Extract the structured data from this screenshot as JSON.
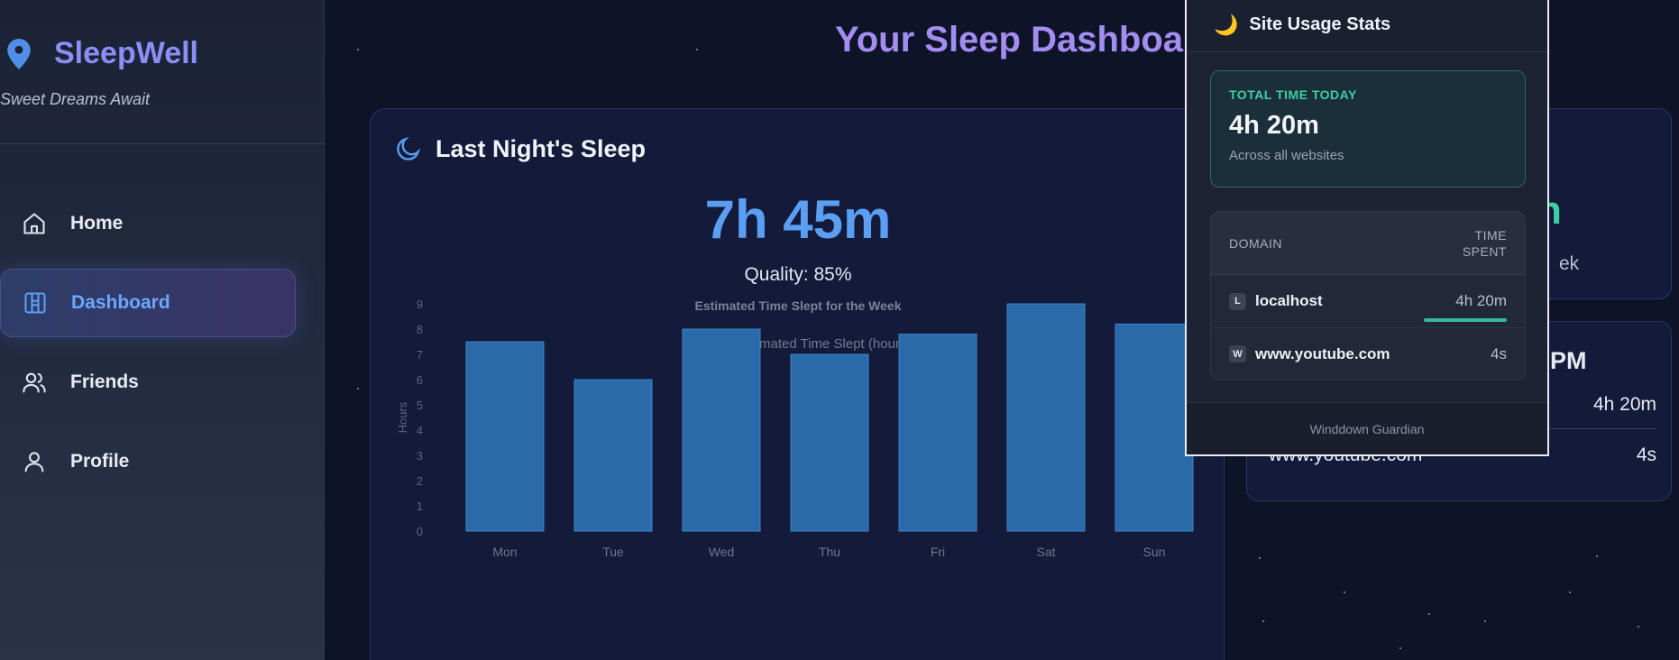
{
  "colors": {
    "background": "#0e1428",
    "accent": "#5b9ef2",
    "brand": "#8b8ff5",
    "bar_fill": "#2b6aa8",
    "teal": "#3ccfa4"
  },
  "sidebar": {
    "brand_title": "SleepWell",
    "tagline": "Sweet Dreams Await",
    "items": [
      {
        "label": "Home",
        "icon": "home-icon",
        "active": false
      },
      {
        "label": "Dashboard",
        "icon": "dashboard-icon",
        "active": true
      },
      {
        "label": "Friends",
        "icon": "users-icon",
        "active": false
      },
      {
        "label": "Profile",
        "icon": "user-icon",
        "active": false
      }
    ]
  },
  "main": {
    "title": "Your Sleep Dashboard",
    "sleep_card": {
      "heading": "Last Night's Sleep",
      "duration": "7h 45m",
      "quality": "Quality: 85%"
    },
    "right_cards": {
      "stat_value_fragment": "n",
      "stat_label_fragment": "ek",
      "time_heading_fragment": "PM",
      "row1_value": "4h 20m",
      "row2_domain": "www.youtube.com",
      "row2_value": "4s"
    }
  },
  "chart_data": {
    "type": "bar",
    "title": "Estimated Time Slept for the Week",
    "legend": [
      "Estimated Time Slept (hours)"
    ],
    "ylabel": "Hours",
    "xlabel": "",
    "categories": [
      "Mon",
      "Tue",
      "Wed",
      "Thu",
      "Fri",
      "Sat",
      "Sun"
    ],
    "values": [
      7.5,
      6,
      8,
      7,
      7.8,
      9,
      8.2
    ],
    "ylim": [
      0,
      9
    ],
    "yticks": [
      "0",
      "1",
      "2",
      "3",
      "4",
      "5",
      "6",
      "7",
      "8",
      "9"
    ],
    "grid": false,
    "legend_position": "top"
  },
  "popup": {
    "title": "Site Usage Stats",
    "moon_glyph": "🌙",
    "total": {
      "label": "TOTAL TIME TODAY",
      "value": "4h 20m",
      "sub": "Across all websites"
    },
    "table": {
      "col_domain": "DOMAIN",
      "col_time_line1": "TIME",
      "col_time_line2": "SPENT",
      "rows": [
        {
          "favicon": "L",
          "domain": "localhost",
          "time": "4h 20m",
          "share": 1.0
        },
        {
          "favicon": "W",
          "domain": "www.youtube.com",
          "time": "4s",
          "share": 0.0
        }
      ]
    },
    "footer": "Winddown Guardian"
  }
}
